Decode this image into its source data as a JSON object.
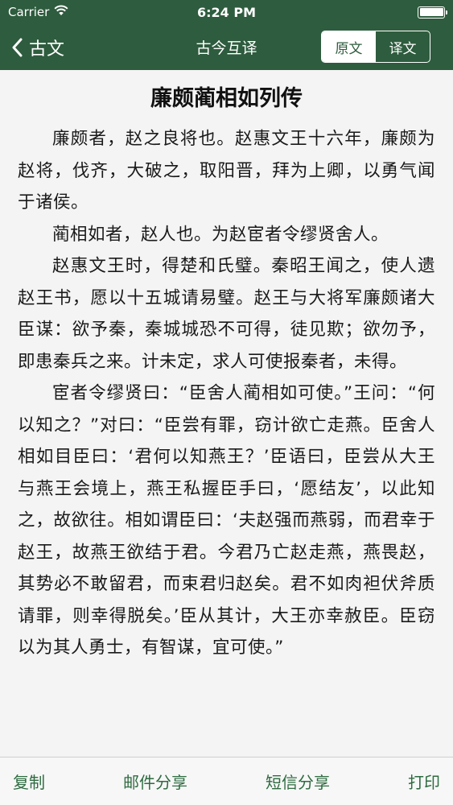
{
  "status_bar": {
    "carrier": "Carrier",
    "time": "6:24 PM"
  },
  "nav": {
    "back_label": "古文",
    "title": "古今互译",
    "segments": [
      "原文",
      "译文"
    ],
    "selected_segment": "原文"
  },
  "article": {
    "title": "廉颇蔺相如列传",
    "paragraphs": [
      "廉颇者，赵之良将也。赵惠文王十六年，廉颇为赵将，伐齐，大破之，取阳晋，拜为上卿，以勇气闻于诸侯。",
      "蔺相如者，赵人也。为赵宦者令缪贤舍人。",
      "赵惠文王时，得楚和氏璧。秦昭王闻之，使人遗赵王书，愿以十五城请易璧。赵王与大将军廉颇诸大臣谋：欲予秦，秦城城恐不可得，徒见欺；欲勿予，即患秦兵之来。计未定，求人可使报秦者，未得。",
      "宦者令缪贤曰：“臣舍人蔺相如可使。”王问：“何以知之？”对曰：“臣尝有罪，窃计欲亡走燕。臣舍人相如目臣曰：‘君何以知燕王？’臣语曰，臣尝从大王与燕王会境上，燕王私握臣手曰，‘愿结友’，以此知之，故欲往。相如谓臣曰：‘夫赵强而燕弱，而君幸于赵王，故燕王欲结于君。今君乃亡赵走燕，燕畏赵，其势必不敢留君，而束君归赵矣。君不如肉袒伏斧质请罪，则幸得脱矣。’臣从其计，大王亦幸赦臣。臣窃以为其人勇士，有智谋，宜可使。”"
    ]
  },
  "bottom_bar": {
    "copy": "复制",
    "mail_share": "邮件分享",
    "sms_share": "短信分享",
    "print": "打印"
  },
  "colors": {
    "primary": "#2e5c3e",
    "accent_text": "#2e6b40",
    "background": "#f4f4f4"
  },
  "icons": {
    "wifi": "wifi-icon",
    "battery": "battery-icon",
    "back": "chevron-left-icon"
  }
}
